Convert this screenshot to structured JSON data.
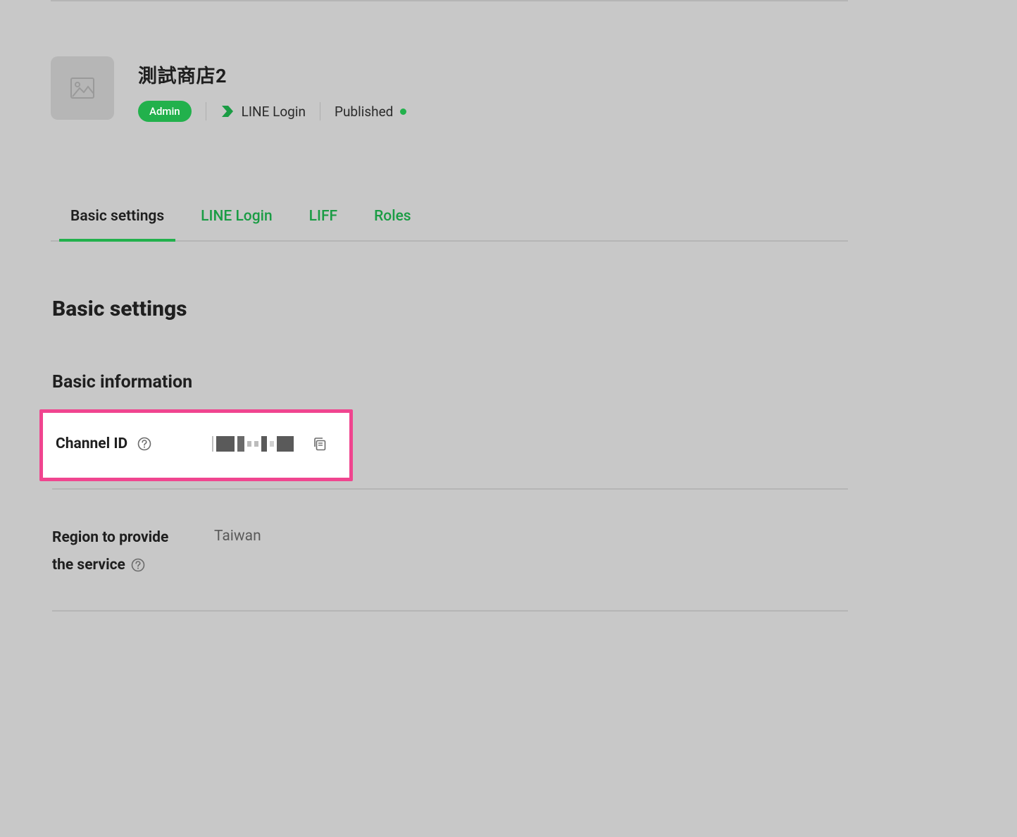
{
  "header": {
    "title": "測試商店2",
    "admin_badge": "Admin",
    "login_type": "LINE Login",
    "status_text": "Published"
  },
  "tabs": [
    {
      "label": "Basic settings",
      "active": true
    },
    {
      "label": "LINE Login",
      "active": false
    },
    {
      "label": "LIFF",
      "active": false
    },
    {
      "label": "Roles",
      "active": false
    }
  ],
  "sections": {
    "basic_settings_heading": "Basic settings",
    "basic_information_heading": "Basic information"
  },
  "fields": {
    "channel_id": {
      "label": "Channel ID",
      "value_redacted": true
    },
    "region": {
      "label_line1": "Region to provide",
      "label_line2": "the service",
      "value": "Taiwan"
    }
  }
}
